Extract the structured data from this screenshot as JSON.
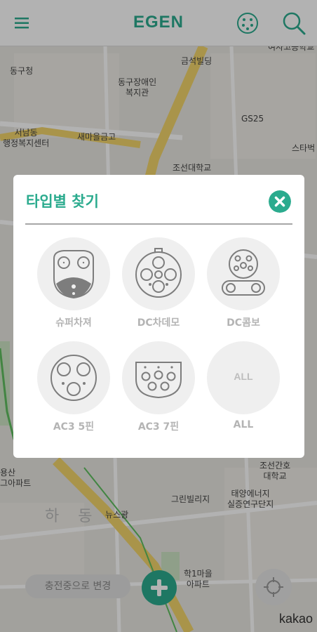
{
  "header": {
    "title": "EGEN"
  },
  "map": {
    "labels": [
      {
        "text": "동구청"
      },
      {
        "text": "동구장애인\n복지관"
      },
      {
        "text": "금석빌딩"
      },
      {
        "text": "서남동\n행정복지센터"
      },
      {
        "text": "새마을금고"
      },
      {
        "text": "GS25"
      },
      {
        "text": "스타벅"
      },
      {
        "text": "조선대학교"
      },
      {
        "text": "조선간호\n대학교"
      },
      {
        "text": "태양에너지\n실증연구단지"
      },
      {
        "text": "그린빌리지"
      },
      {
        "text": "뉴스광"
      },
      {
        "text": "학1마을\n아파트"
      },
      {
        "text": "용산\n그아파트"
      },
      {
        "text": "하 동"
      },
      {
        "text": "여사고등학교"
      }
    ],
    "attribution": "kakao",
    "status_button": "충전중으로 변경"
  },
  "modal": {
    "title": "타입별 찾기",
    "types": [
      {
        "label": "슈퍼차져"
      },
      {
        "label": "DC차데모"
      },
      {
        "label": "DC콤보"
      },
      {
        "label": "AC3 5핀"
      },
      {
        "label": "AC3 7핀"
      },
      {
        "label": "ALL",
        "icon_text": "ALL"
      }
    ]
  },
  "colors": {
    "accent": "#2bab8e",
    "icon_stroke": "#7d7d7d",
    "tile_bg": "#efefef",
    "label_gray": "#b4b4b4"
  },
  "icons": {
    "menu": "hamburger-menu-icon",
    "plug": "connector-plug-icon",
    "search": "search-icon",
    "close": "close-circle-icon",
    "locate": "crosshair-locate-icon",
    "add": "plus-icon"
  }
}
